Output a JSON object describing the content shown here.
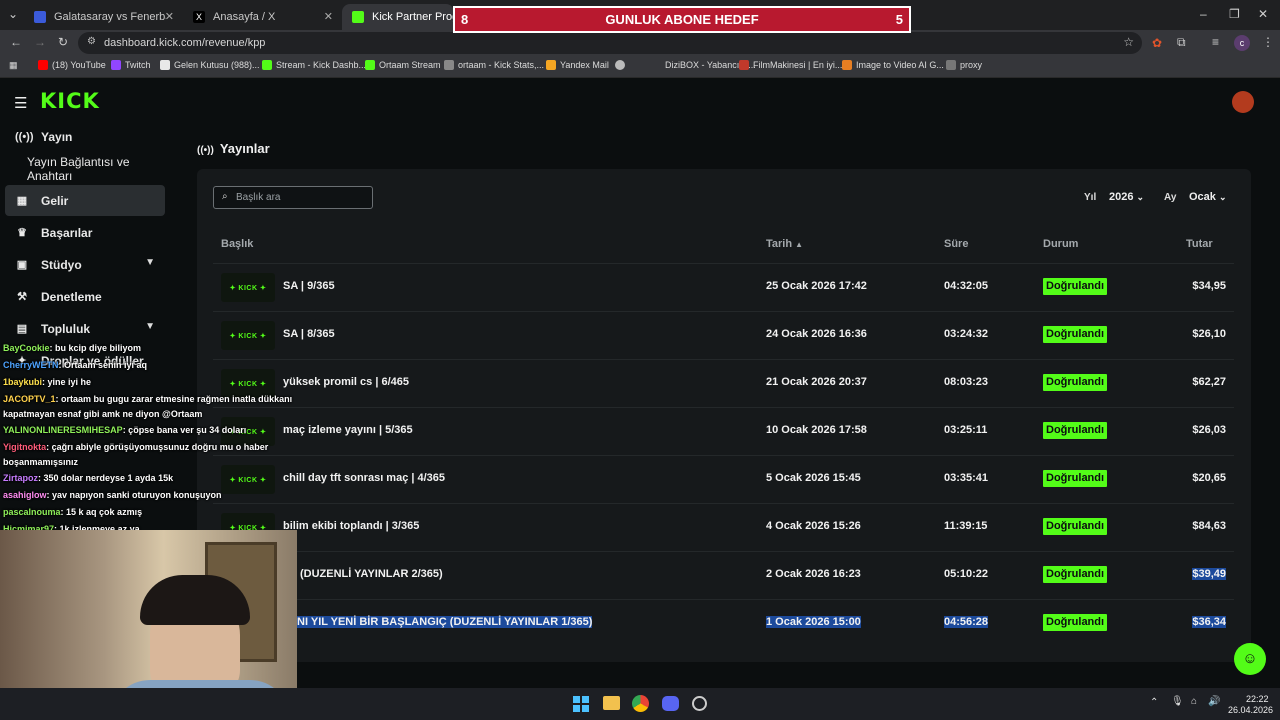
{
  "browser": {
    "tabs": [
      {
        "label": "Galatasaray vs Fenerbahçe live",
        "color": "#3b5bdb"
      },
      {
        "label": "Anasayfa / X",
        "color": "#000000"
      },
      {
        "label": "Kick Partner Program - K",
        "color": "#53fc18"
      }
    ],
    "url": "dashboard.kick.com/revenue/kpp",
    "bookmarks": [
      {
        "label": "(18) YouTube",
        "color": "#ff0000"
      },
      {
        "label": "Twitch",
        "color": "#9146ff"
      },
      {
        "label": "Gelen Kutusu (988)...",
        "color": "#e8e8e8"
      },
      {
        "label": "Stream - Kick Dashb...",
        "color": "#53fc18"
      },
      {
        "label": "Ortaam Stream",
        "color": "#53fc18"
      },
      {
        "label": "ortaam - Kick Stats,...",
        "color": "#888888"
      },
      {
        "label": "Yandex Mail",
        "color": "#f5a623"
      },
      {
        "label": "DiziBOX - Yabancı D...",
        "color": "#bbbbbb"
      },
      {
        "label": "FilmMakinesi | En iyi...",
        "color": "#c0392b"
      },
      {
        "label": "Image to Video AI G...",
        "color": "#e67e22"
      },
      {
        "label": "proxy",
        "color": "#777777"
      }
    ]
  },
  "banner": {
    "left": "8",
    "title": "GUNLUK ABONE HEDEF",
    "right": "5"
  },
  "sidebar": {
    "logo": "KICK",
    "items": [
      {
        "label": "Yayın",
        "icon": "broadcast-icon"
      },
      {
        "label": "Yayın Bağlantısı ve Anahtarı",
        "icon": ""
      },
      {
        "label": "Gelir",
        "icon": "chart-icon"
      },
      {
        "label": "Başarılar",
        "icon": "trophy-icon"
      },
      {
        "label": "Stüdyo",
        "icon": "studio-icon"
      },
      {
        "label": "Denetleme",
        "icon": "hammer-icon"
      },
      {
        "label": "Topluluk",
        "icon": "community-icon"
      },
      {
        "label": "Droplar ve ödüller",
        "icon": "gift-icon"
      }
    ]
  },
  "page": {
    "title": "Yayınlar",
    "search_placeholder": "Başlık ara",
    "year_label": "Yıl",
    "year_value": "2026",
    "month_label": "Ay",
    "month_value": "Ocak"
  },
  "table": {
    "headers": [
      "Başlık",
      "Tarih",
      "Süre",
      "Durum",
      "Tutar"
    ],
    "rows": [
      {
        "title": "SA | 9/365",
        "date": "25 Ocak 2026 17:42",
        "duration": "04:32:05",
        "status": "Doğrulandı",
        "amount": "$34,95"
      },
      {
        "title": "SA | 8/365",
        "date": "24 Ocak 2026 16:36",
        "duration": "03:24:32",
        "status": "Doğrulandı",
        "amount": "$26,10"
      },
      {
        "title": "yüksek promil cs | 6/465",
        "date": "21 Ocak 2026 20:37",
        "duration": "08:03:23",
        "status": "Doğrulandı",
        "amount": "$62,27"
      },
      {
        "title": "maç izleme yayını | 5/365",
        "date": "10 Ocak 2026 17:58",
        "duration": "03:25:11",
        "status": "Doğrulandı",
        "amount": "$26,03"
      },
      {
        "title": "chill day tft sonrası maç | 4/365",
        "date": "5 Ocak 2026 15:45",
        "duration": "03:35:41",
        "status": "Doğrulandı",
        "amount": "$20,65"
      },
      {
        "title": "bilim ekibi toplandı | 3/365",
        "date": "4 Ocak 2026 15:26",
        "duration": "11:39:15",
        "status": "Doğrulandı",
        "amount": "$84,63"
      },
      {
        "title": "(DUZENLİ YAYINLAR 2/365)",
        "date": "2 Ocak 2026 16:23",
        "duration": "05:10:22",
        "status": "Doğrulandı",
        "amount": "$39,49"
      },
      {
        "title": "NI YIL YENİ BİR BAŞLANGIÇ (DUZENLİ YAYINLAR 1/365)",
        "date": "1 Ocak 2026 15:00",
        "duration": "04:56:28",
        "status": "Doğrulandı",
        "amount": "$36,34"
      }
    ]
  },
  "chat": [
    {
      "user": "BayCookie",
      "msg": ": bu kcip diye biliyom",
      "color": "#8ff05a"
    },
    {
      "user": "CherryWETN",
      "msg": ": Ortaam senin iyi aq",
      "color": "#4da3ff"
    },
    {
      "user": "1baykubi",
      "msg": ": yine iyi he",
      "color": "#ffe14d"
    },
    {
      "user": "JACOPTV_1",
      "msg": ": ortaam bu gugu zarar etmesine rağmen inatla dükkanı",
      "color": "#ffd24d"
    },
    {
      "user": "",
      "msg": "kapatmayan esnaf gibi amk ne diyon @Ortaam",
      "color": "#ffffff"
    },
    {
      "user": "YALINONLINERESMIHESAP",
      "msg": ": çöpse bana ver şu 34 doları",
      "color": "#8ff05a"
    },
    {
      "user": "Yigitnokta",
      "msg": ": çağrı abiyle görüşüyomuşsunuz doğru mu o haber",
      "color": "#ff5c7a"
    },
    {
      "user": "",
      "msg": "boşanmamışsınız",
      "color": "#ffffff"
    },
    {
      "user": "Zirtapoz",
      "msg": ": 350 dolar nerdeyse 1 ayda 15k",
      "color": "#c77dff"
    },
    {
      "user": "asahiglow",
      "msg": ": yav napıyon sanki oturuyon konuşuyon",
      "color": "#ff8cf0"
    },
    {
      "user": "pascalnouma",
      "msg": ": 15 k aq çok azmış",
      "color": "#8ff05a"
    },
    {
      "user": "Hicmimar97",
      "msg": ": 1k izlenmeye az ya",
      "color": "#8ff05a"
    }
  ],
  "taskbar": {
    "time": "22:22",
    "date": "26.04.2026"
  }
}
